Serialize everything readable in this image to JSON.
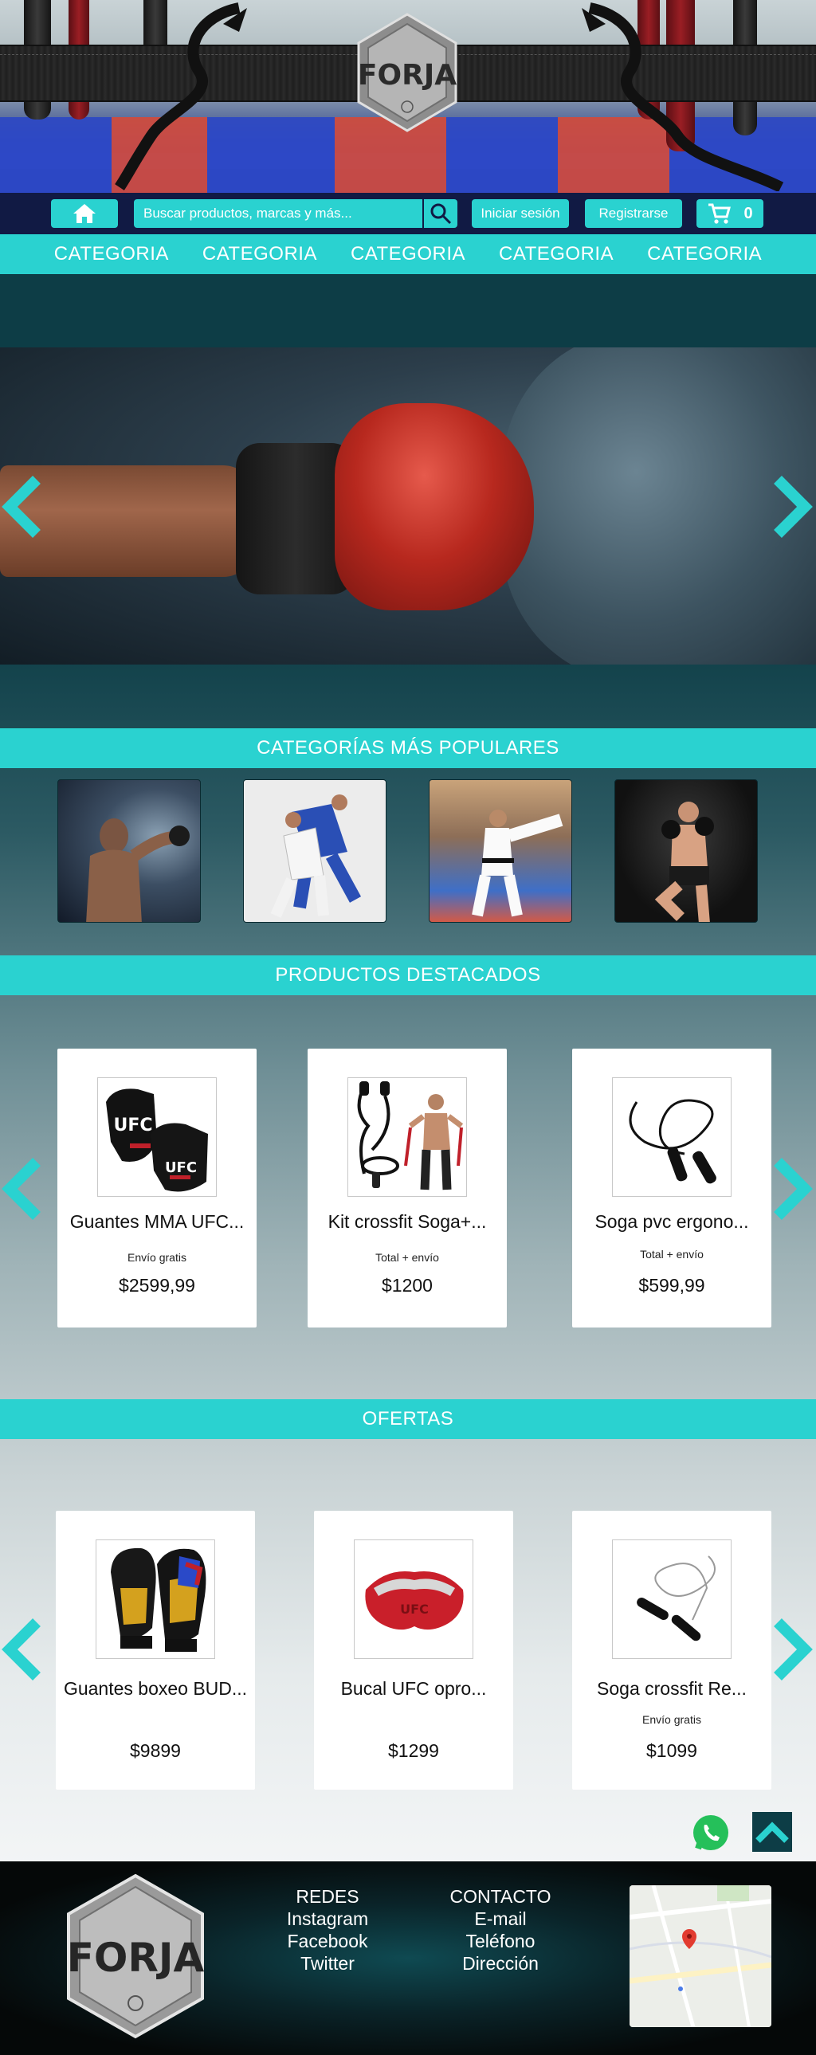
{
  "brand": {
    "name": "FORJA"
  },
  "header": {
    "search_placeholder": "Buscar productos, marcas y más...",
    "login_label": "Iniciar sesión",
    "register_label": "Registrarse",
    "cart_count": "0"
  },
  "categories": [
    "CATEGORIA",
    "CATEGORIA",
    "CATEGORIA",
    "CATEGORIA",
    "CATEGORIA"
  ],
  "sections": {
    "popular": "CATEGORÍAS MÁS POPULARES",
    "featured": "PRODUCTOS DESTACADOS",
    "offers": "OFERTAS"
  },
  "featured_products": [
    {
      "name": "Guantes MMA UFC...",
      "tag": "Envío gratis",
      "price": "$2599,99"
    },
    {
      "name": "Kit crossfit Soga+...",
      "tag": "Total + envío",
      "price": "$1200"
    },
    {
      "name": "Soga pvc ergono...",
      "tag": "Total + envío",
      "price": "$599,99"
    }
  ],
  "offer_products": [
    {
      "name": "Guantes boxeo BUD...",
      "tag": "",
      "price": "$9899"
    },
    {
      "name": "Bucal UFC opro...",
      "tag": "",
      "price": "$1299"
    },
    {
      "name": "Soga crossfit Re...",
      "tag": "Envío gratis",
      "price": "$1099"
    }
  ],
  "footer": {
    "social_title": "REDES",
    "social_links": [
      "Instagram",
      "Facebook",
      "Twitter"
    ],
    "contact_title": "CONTACTO",
    "contact_links": [
      "E-mail",
      "Teléfono",
      "Dirección"
    ]
  },
  "colors": {
    "accent": "#2ad2d0",
    "navbar": "#111a44",
    "dark_teal": "#0d3d46"
  },
  "icons": [
    "home-icon",
    "search-icon",
    "cart-icon",
    "chevron-left-icon",
    "chevron-right-icon",
    "whatsapp-icon",
    "chevron-up-icon"
  ]
}
